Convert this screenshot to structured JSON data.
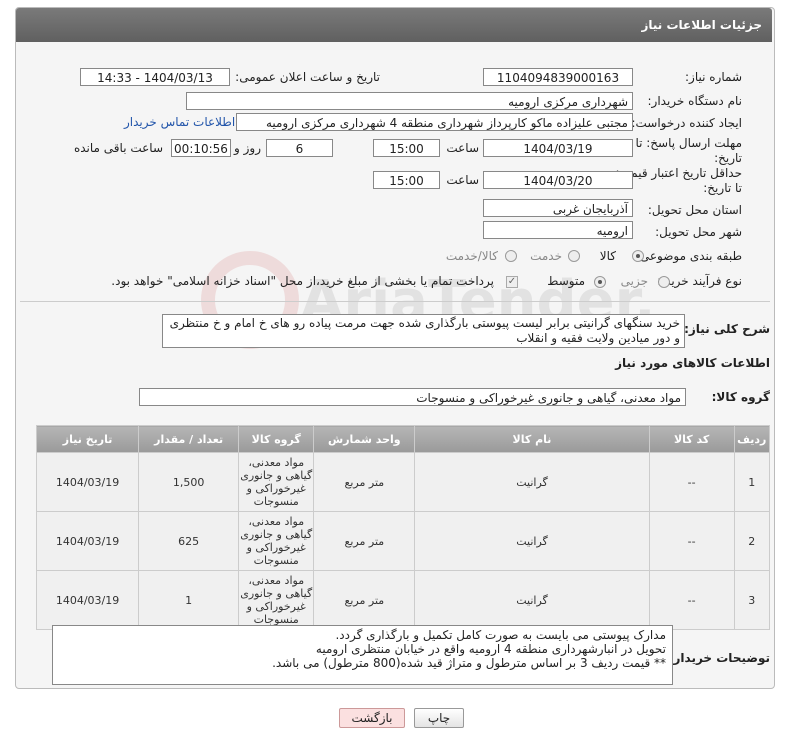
{
  "header": {
    "title": "جزئیات اطلاعات نیاز"
  },
  "form": {
    "need_number_label": "شماره نیاز:",
    "need_number": "1104094839000163",
    "announce_label": "تاریخ و ساعت اعلان عمومی:",
    "announce_value": "1404/03/13 - 14:33",
    "buyer_org_label": "نام دستگاه خریدار:",
    "buyer_org": "شهرداری مرکزی ارومیه",
    "creator_label": "ایجاد کننده درخواست:",
    "creator": "مجتبی علیزاده ماکو کارپرداز شهرداری منطقه 4 شهرداری مرکزی ارومیه",
    "contact_link": "اطلاعات تماس خریدار",
    "deadline_label_1": "مهلت ارسال پاسخ: تا",
    "deadline_label_2": "تاریخ:",
    "deadline_date": "1404/03/19",
    "time_label": "ساعت",
    "deadline_time": "15:00",
    "days_value": "6",
    "days_label": "روز و",
    "remaining_time": "00:10:56",
    "remaining_label": "ساعت باقی مانده",
    "price_label_1": "حداقل تاریخ اعتبار قیمت:",
    "price_label_2": "تا تاریخ:",
    "price_date": "1404/03/20",
    "price_time": "15:00",
    "province_label": "استان محل تحویل:",
    "province": "آذربایجان غربی",
    "city_label": "شهر محل تحویل:",
    "city": "ارومیه",
    "category_label": "طبقه بندی موضوعی:",
    "category_options": [
      "کالا",
      "خدمت",
      "کالا/خدمت"
    ],
    "process_label": "نوع فرآیند خرید :",
    "process_options": [
      "جزیی",
      "متوسط"
    ],
    "payment_note": "پرداخت تمام یا بخشی از مبلغ خرید،از محل \"اسناد خزانه اسلامی\" خواهد بود.",
    "description_label": "شرح کلی نیاز:",
    "description": "خرید سنگهای گرانیتی برابر لیست پیوستی بارگذاری شده جهت مرمت پیاده رو های خ امام و خ منتظری و دور میادین ولایت فقیه و انقلاب"
  },
  "goods": {
    "section_title": "اطلاعات کالاهای مورد نیاز",
    "group_label": "گروه کالا:",
    "group_value": "مواد معدنی، گیاهی و جانوری غیرخوراکی و منسوجات",
    "columns": [
      "ردیف",
      "کد کالا",
      "نام کالا",
      "واحد شمارش",
      "گروه کالا",
      "تعداد / مقدار",
      "تاریخ نیاز"
    ],
    "rows": [
      {
        "row": "1",
        "code": "--",
        "name": "گرانیت",
        "unit": "متر مربع",
        "group": "مواد معدنی، گیاهی و جانوری غیرخوراکی و منسوجات",
        "qty": "1,500",
        "date": "1404/03/19"
      },
      {
        "row": "2",
        "code": "--",
        "name": "گرانیت",
        "unit": "متر مربع",
        "group": "مواد معدنی، گیاهی و جانوری غیرخوراکی و منسوجات",
        "qty": "625",
        "date": "1404/03/19"
      },
      {
        "row": "3",
        "code": "--",
        "name": "گرانیت",
        "unit": "متر مربع",
        "group": "مواد معدنی، گیاهی و جانوری غیرخوراکی و منسوجات",
        "qty": "1",
        "date": "1404/03/19"
      }
    ]
  },
  "notes": {
    "label": "توضیحات خریدار:",
    "text": "مدارک پیوستی می بایست به صورت کامل تکمیل و بارگذاری گردد.\nتحویل در انبارشهرداری منطقه 4 ارومیه واقع در خیابان منتظری ارومیه\n** قیمت ردیف 3 بر اساس مترطول و متراژ قید شده(800 مترطول) می باشد."
  },
  "buttons": {
    "print": "چاپ",
    "back": "بازگشت"
  },
  "watermark": {
    "text": "AriaTender.net"
  }
}
